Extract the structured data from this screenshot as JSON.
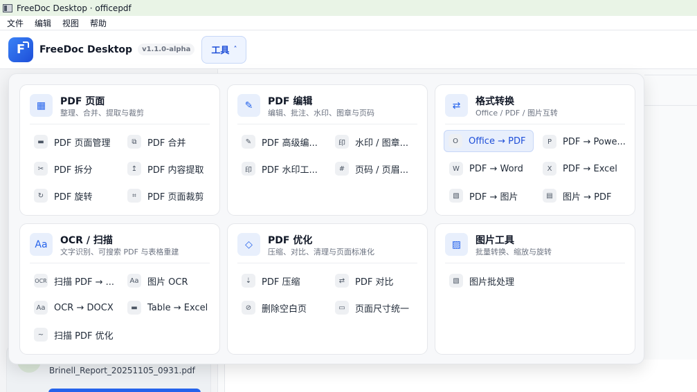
{
  "window": {
    "title": "FreeDoc Desktop · officepdf"
  },
  "menu": [
    "文件",
    "编辑",
    "视图",
    "帮助"
  ],
  "header": {
    "brand": "FreeDoc Desktop",
    "version": "v1.1.0-alpha",
    "tools_label": "工具",
    "tools_caret": "˄"
  },
  "background": {
    "recent_file": "Brinell_Report_20251105_0931.pdf"
  },
  "cards": [
    {
      "title": "PDF 页面",
      "subtitle": "整理、合并、提取与裁剪",
      "icon": "grid-icon",
      "items": [
        {
          "label": "PDF 页面管理",
          "icon": "page-icon"
        },
        {
          "label": "PDF 合并",
          "icon": "merge-icon"
        },
        {
          "label": "PDF 拆分",
          "icon": "scissors-icon"
        },
        {
          "label": "PDF 内容提取",
          "icon": "extract-icon"
        },
        {
          "label": "PDF 旋转",
          "icon": "rotate-icon"
        },
        {
          "label": "PDF 页面裁剪",
          "icon": "crop-icon"
        }
      ]
    },
    {
      "title": "PDF 编辑",
      "subtitle": "编辑、批注、水印、图章与页码",
      "icon": "pen-icon",
      "items": [
        {
          "label": "PDF 高级编...",
          "icon": "pen-icon"
        },
        {
          "label": "水印 / 图章...",
          "icon": "stamp-icon"
        },
        {
          "label": "PDF 水印工...",
          "icon": "stamp-icon"
        },
        {
          "label": "页码 / 页眉...",
          "icon": "hash-icon"
        }
      ]
    },
    {
      "title": "格式转换",
      "subtitle": "Office / PDF / 图片互转",
      "icon": "swap-icon",
      "items": [
        {
          "label": "Office → PDF",
          "icon": "office-icon",
          "active": true
        },
        {
          "label": "PDF → Powe...",
          "icon": "powerpoint-icon"
        },
        {
          "label": "PDF → Word",
          "icon": "word-icon"
        },
        {
          "label": "PDF → Excel",
          "icon": "excel-icon"
        },
        {
          "label": "PDF → 图片",
          "icon": "image-icon"
        },
        {
          "label": "图片 → PDF",
          "icon": "image-to-pdf-icon"
        }
      ]
    },
    {
      "title": "OCR / 扫描",
      "subtitle": "文字识别、可搜索 PDF 与表格重建",
      "icon": "text-aa-icon",
      "items": [
        {
          "label": "扫描 PDF → ...",
          "icon": "ocr-icon"
        },
        {
          "label": "图片 OCR",
          "icon": "text-aa-icon"
        },
        {
          "label": "OCR → DOCX",
          "icon": "text-aa-icon"
        },
        {
          "label": "Table → Excel",
          "icon": "table-icon"
        },
        {
          "label": "扫描 PDF 优化",
          "icon": "wave-icon"
        }
      ]
    },
    {
      "title": "PDF 优化",
      "subtitle": "压缩、对比、清理与页面标准化",
      "icon": "diamond-icon",
      "items": [
        {
          "label": "PDF 压缩",
          "icon": "compress-icon"
        },
        {
          "label": "PDF 对比",
          "icon": "compare-icon"
        },
        {
          "label": "删除空白页",
          "icon": "delete-blank-icon"
        },
        {
          "label": "页面尺寸统一",
          "icon": "page-size-icon"
        }
      ]
    },
    {
      "title": "图片工具",
      "subtitle": "批量转换、缩放与旋转",
      "icon": "image-tools-icon",
      "items": [
        {
          "label": "图片批处理",
          "icon": "image-icon"
        }
      ]
    }
  ]
}
